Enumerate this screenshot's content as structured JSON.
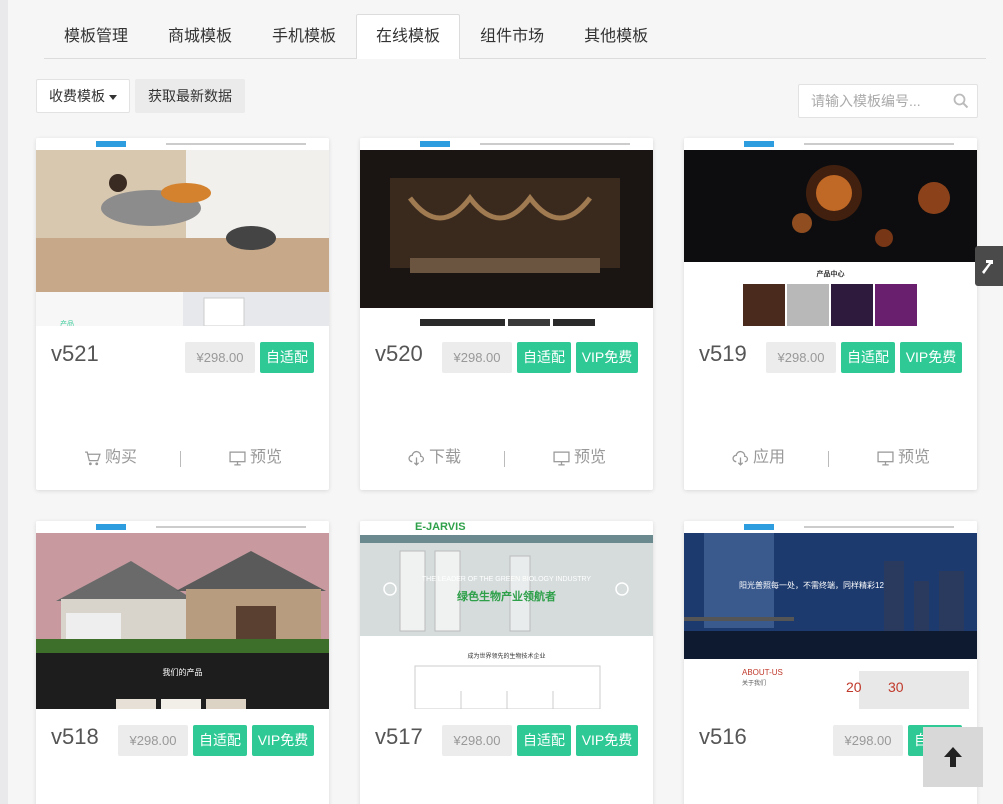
{
  "tabs": [
    {
      "label": "模板管理",
      "active": false
    },
    {
      "label": "商城模板",
      "active": false
    },
    {
      "label": "手机模板",
      "active": false
    },
    {
      "label": "在线模板",
      "active": true
    },
    {
      "label": "组件市场",
      "active": false
    },
    {
      "label": "其他模板",
      "active": false
    }
  ],
  "toolbar": {
    "filter_label": "收费模板",
    "fetch_label": "获取最新数据",
    "search_placeholder": "请输入模板编号..."
  },
  "cards": [
    {
      "version": "v521",
      "price": "¥298.00",
      "tags": [
        "自适配"
      ],
      "actions": [
        "购买",
        "预览"
      ],
      "thumb_text": [
        "产品"
      ]
    },
    {
      "version": "v520",
      "price": "¥298.00",
      "tags": [
        "自适配",
        "VIP免费"
      ],
      "actions": [
        "下载",
        "预览"
      ],
      "thumb_text": []
    },
    {
      "version": "v519",
      "price": "¥298.00",
      "tags": [
        "自适配",
        "VIP免费"
      ],
      "actions": [
        "应用",
        "预览"
      ],
      "thumb_text": [
        "产品中心"
      ]
    },
    {
      "version": "v518",
      "price": "¥298.00",
      "tags": [
        "自适配",
        "VIP免费"
      ],
      "actions": [],
      "thumb_text": [
        "我们的产品"
      ]
    },
    {
      "version": "v517",
      "price": "¥298.00",
      "tags": [
        "自适配",
        "VIP免费"
      ],
      "actions": [],
      "thumb_text": [
        "E-JARVIS",
        "THE LEADER OF THE GREEN BIOLOGY INDUSTRY",
        "绿色生物产业领航者",
        "成为世界领先的生物技术企业"
      ]
    },
    {
      "version": "v516",
      "price": "¥298.00",
      "tags": [
        "自适配"
      ],
      "actions": [],
      "thumb_text": [
        "阳光普照每一处，不需终端，同样精彩12",
        "ABOUT-US",
        "关于我们",
        "20",
        "30"
      ]
    }
  ],
  "colors": {
    "accent": "#2fc996",
    "price_bg": "#ececec"
  }
}
